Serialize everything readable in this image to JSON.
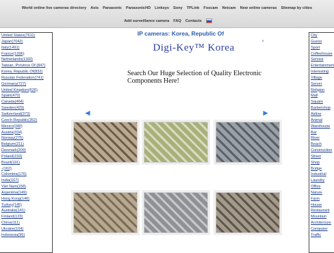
{
  "nav": {
    "row1": [
      "World online live cameras directory",
      "Axis",
      "Panasonic",
      "PanasonicHD",
      "Linksys",
      "Sony",
      "TPLink",
      "Foscam",
      "Netcam",
      "New online cameras",
      "Sitemap by cities"
    ],
    "row2": [
      "Add surveillance camera",
      "FAQ",
      "Contacts"
    ]
  },
  "countries": [
    "United States(7611)",
    "Japan(7042)",
    "Italy(1491)",
    "France(1396)",
    "Netherlands(1160)",
    "Taiwan, Province Of (847)",
    "Korea, Republic Of(832)",
    "Russian Federation(741)",
    "Germany(727)",
    "United Kingdom(626)",
    "Spain(470)",
    "Canada(464)",
    "Sweden(429)",
    "Switzerland(373)",
    "Czech Republic(352)",
    "Mexico(340)",
    "Austria(334)",
    "Norway(275)",
    "Belgium(211)",
    "Denmark(209)",
    "Poland(193)",
    "Brazil(191)",
    "-(162)",
    "Colombia(176)",
    "India(167)",
    "Viet Nam(158)",
    "Argentina(149)",
    "Hong Kong(146)",
    "Turkey(145)",
    "Australia(141)",
    "Finland(123)",
    "China(111)",
    "Ukraine(104)",
    "Indonesia(95)"
  ],
  "cities": [
    "City",
    "Guess",
    "Sport",
    "Coffeehouse",
    "Service",
    "Entertainment",
    "Interesting",
    "Village",
    "Server",
    "Religion",
    "Mall",
    "Square",
    "Barbershop",
    "Airline",
    "Animal",
    "Warehouse",
    "Bar",
    "River",
    "Beach",
    "Construction",
    "Street",
    "Shop",
    "Bridge",
    "Industrial",
    "Laundry",
    "Office",
    "Nature",
    "Farm",
    "House",
    "Restaurant",
    "Mountain",
    "Architecture",
    "Computer",
    "Traffic"
  ],
  "main": {
    "heading": "IP cameras: Korea, Republic Of"
  },
  "ad": {
    "brand": "Digi-Key™ Korea",
    "text": "Search Our Huge Selection of Quality Electronic Components Here!",
    "button_symbol": "→",
    "close": "×"
  },
  "pager": {
    "prev": "◄",
    "next": "►"
  },
  "cameras": [
    {
      "theme": "#b9aa8f",
      "accent": "#6b5a4a"
    },
    {
      "theme": "#a9b07a",
      "accent": "#d8dcc0"
    },
    {
      "theme": "#9aa0a8",
      "accent": "#5a5f66"
    },
    {
      "theme": "#b7a98f",
      "accent": "#7a6a58"
    },
    {
      "theme": "#8f9196",
      "accent": "#c9c9c9"
    },
    {
      "theme": "#a39a8c",
      "accent": "#5e554a"
    }
  ]
}
